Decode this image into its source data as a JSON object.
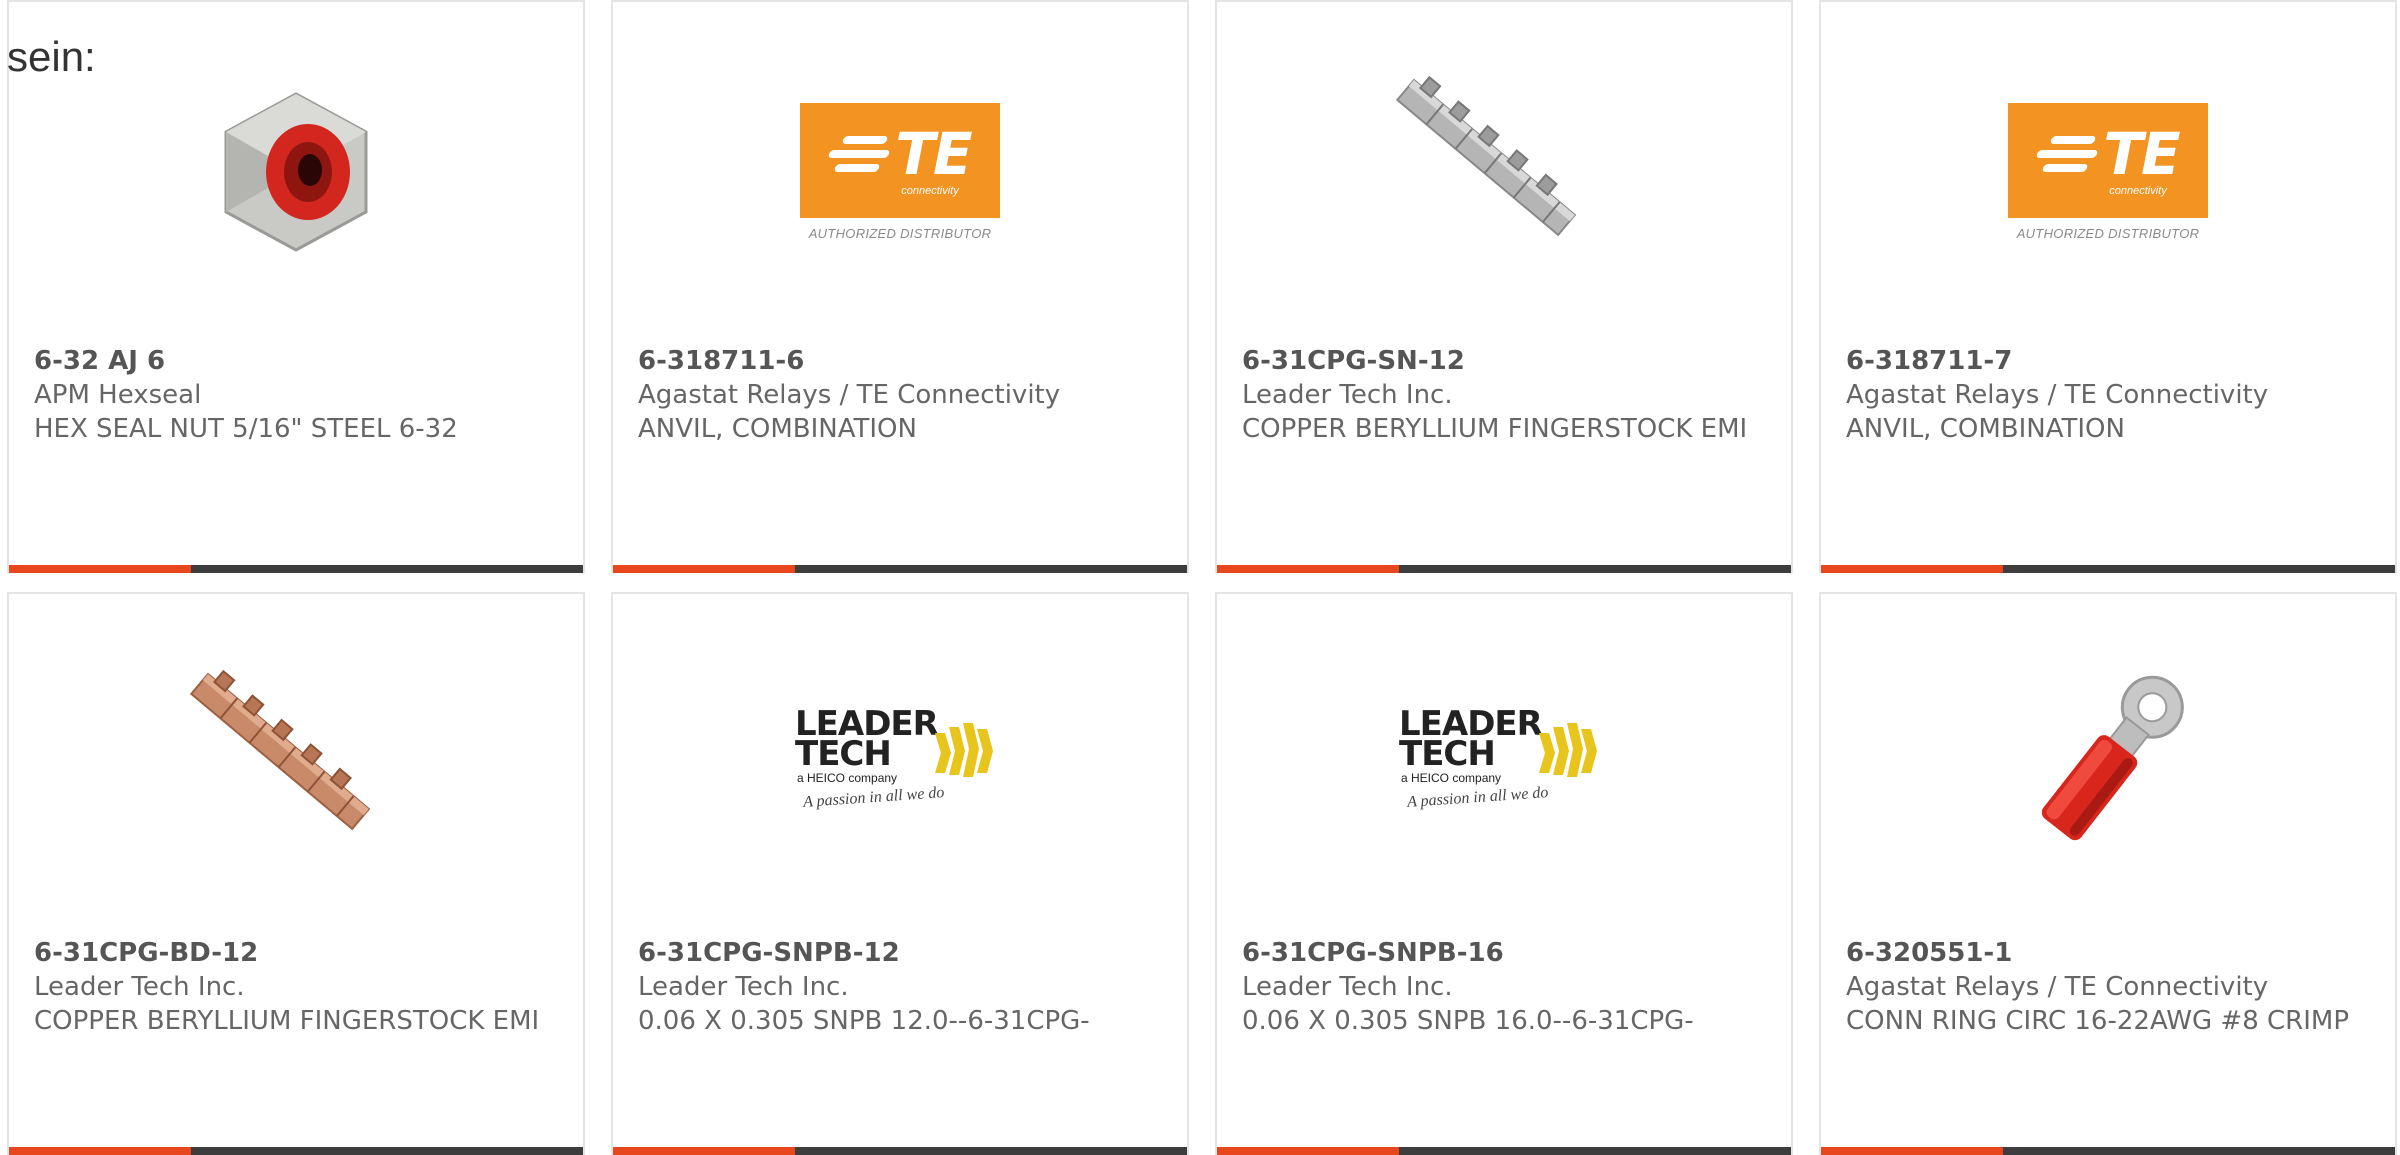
{
  "page": {
    "top_text": "sein:"
  },
  "cards": [
    {
      "part_number": "6-32 AJ 6",
      "manufacturer": "APM Hexseal",
      "description": "HEX SEAL NUT 5/16\" STEEL 6-32",
      "image": "hex-nut-icon"
    },
    {
      "part_number": "6-318711-6",
      "manufacturer": "Agastat Relays / TE Connectivity",
      "description": "ANVIL, COMBINATION",
      "image": "te-logo"
    },
    {
      "part_number": "6-31CPG-SN-12",
      "manufacturer": "Leader Tech Inc.",
      "description": "COPPER BERYLLIUM FINGERSTOCK EMI",
      "image": "fingerstock-silver-icon"
    },
    {
      "part_number": "6-318711-7",
      "manufacturer": "Agastat Relays / TE Connectivity",
      "description": "ANVIL, COMBINATION",
      "image": "te-logo"
    },
    {
      "part_number": "6-31CPG-BD-12",
      "manufacturer": "Leader Tech Inc.",
      "description": "COPPER BERYLLIUM FINGERSTOCK EMI",
      "image": "fingerstock-copper-icon"
    },
    {
      "part_number": "6-31CPG-SNPB-12",
      "manufacturer": "Leader Tech Inc.",
      "description": "0.06 X 0.305 SNPB 12.0--6-31CPG-",
      "image": "leader-tech-logo"
    },
    {
      "part_number": "6-31CPG-SNPB-16",
      "manufacturer": "Leader Tech Inc.",
      "description": "0.06 X 0.305 SNPB 16.0--6-31CPG-",
      "image": "leader-tech-logo"
    },
    {
      "part_number": "6-320551-1",
      "manufacturer": "Agastat Relays / TE Connectivity",
      "description": "CONN RING CIRC 16-22AWG #8 CRIMP",
      "image": "ring-terminal-icon"
    }
  ],
  "logos": {
    "te": {
      "main": "TE",
      "sub": "connectivity",
      "tagline": "AUTHORIZED DISTRIBUTOR"
    },
    "leader_tech": {
      "line1": "LEADER",
      "line2": "TECH",
      "heico": "a HEICO company",
      "tagline": "A passion in all we do"
    }
  },
  "colors": {
    "accent": "#e8461c",
    "bar": "#3d3d3d",
    "te_orange": "#f39321",
    "leader_yellow": "#e8c51c"
  }
}
